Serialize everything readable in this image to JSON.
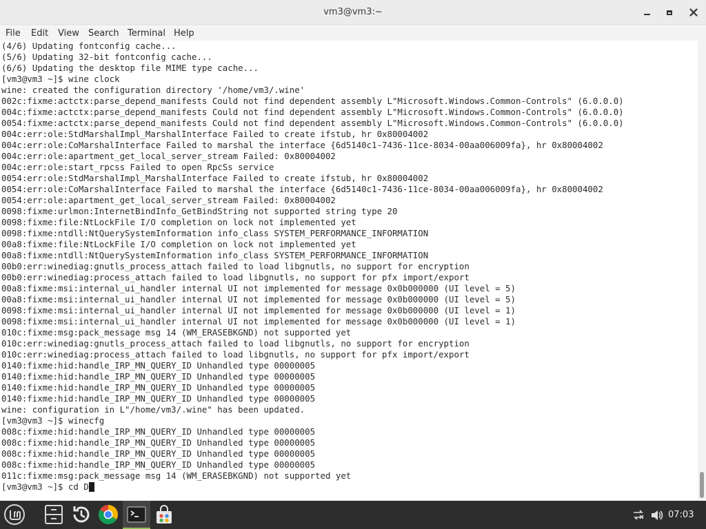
{
  "window": {
    "title": "vm3@vm3:~"
  },
  "menubar": {
    "items": [
      "File",
      "Edit",
      "View",
      "Search",
      "Terminal",
      "Help"
    ]
  },
  "terminal": {
    "lines": [
      "(4/6) Updating fontconfig cache...",
      "(5/6) Updating 32-bit fontconfig cache...",
      "(6/6) Updating the desktop file MIME type cache...",
      "[vm3@vm3 ~]$ wine clock",
      "wine: created the configuration directory '/home/vm3/.wine'",
      "002c:fixme:actctx:parse_depend_manifests Could not find dependent assembly L\"Microsoft.Windows.Common-Controls\" (6.0.0.0)",
      "004c:fixme:actctx:parse_depend_manifests Could not find dependent assembly L\"Microsoft.Windows.Common-Controls\" (6.0.0.0)",
      "0054:fixme:actctx:parse_depend_manifests Could not find dependent assembly L\"Microsoft.Windows.Common-Controls\" (6.0.0.0)",
      "004c:err:ole:StdMarshalImpl_MarshalInterface Failed to create ifstub, hr 0x80004002",
      "004c:err:ole:CoMarshalInterface Failed to marshal the interface {6d5140c1-7436-11ce-8034-00aa006009fa}, hr 0x80004002",
      "004c:err:ole:apartment_get_local_server_stream Failed: 0x80004002",
      "004c:err:ole:start_rpcss Failed to open RpcSs service",
      "0054:err:ole:StdMarshalImpl_MarshalInterface Failed to create ifstub, hr 0x80004002",
      "0054:err:ole:CoMarshalInterface Failed to marshal the interface {6d5140c1-7436-11ce-8034-00aa006009fa}, hr 0x80004002",
      "0054:err:ole:apartment_get_local_server_stream Failed: 0x80004002",
      "0098:fixme:urlmon:InternetBindInfo_GetBindString not supported string type 20",
      "0098:fixme:file:NtLockFile I/O completion on lock not implemented yet",
      "0098:fixme:ntdll:NtQuerySystemInformation info_class SYSTEM_PERFORMANCE_INFORMATION",
      "00a8:fixme:file:NtLockFile I/O completion on lock not implemented yet",
      "00a8:fixme:ntdll:NtQuerySystemInformation info_class SYSTEM_PERFORMANCE_INFORMATION",
      "00b0:err:winediag:gnutls_process_attach failed to load libgnutls, no support for encryption",
      "00b0:err:winediag:process_attach failed to load libgnutls, no support for pfx import/export",
      "00a8:fixme:msi:internal_ui_handler internal UI not implemented for message 0x0b000000 (UI level = 5)",
      "00a8:fixme:msi:internal_ui_handler internal UI not implemented for message 0x0b000000 (UI level = 5)",
      "0098:fixme:msi:internal_ui_handler internal UI not implemented for message 0x0b000000 (UI level = 1)",
      "0098:fixme:msi:internal_ui_handler internal UI not implemented for message 0x0b000000 (UI level = 1)",
      "010c:fixme:msg:pack_message msg 14 (WM_ERASEBKGND) not supported yet",
      "010c:err:winediag:gnutls_process_attach failed to load libgnutls, no support for encryption",
      "010c:err:winediag:process_attach failed to load libgnutls, no support for pfx import/export",
      "0140:fixme:hid:handle_IRP_MN_QUERY_ID Unhandled type 00000005",
      "0140:fixme:hid:handle_IRP_MN_QUERY_ID Unhandled type 00000005",
      "0140:fixme:hid:handle_IRP_MN_QUERY_ID Unhandled type 00000005",
      "0140:fixme:hid:handle_IRP_MN_QUERY_ID Unhandled type 00000005",
      "wine: configuration in L\"/home/vm3/.wine\" has been updated.",
      "[vm3@vm3 ~]$ winecfg",
      "008c:fixme:hid:handle_IRP_MN_QUERY_ID Unhandled type 00000005",
      "008c:fixme:hid:handle_IRP_MN_QUERY_ID Unhandled type 00000005",
      "008c:fixme:hid:handle_IRP_MN_QUERY_ID Unhandled type 00000005",
      "008c:fixme:hid:handle_IRP_MN_QUERY_ID Unhandled type 00000005",
      "011c:fixme:msg:pack_message msg 14 (WM_ERASEBKGND) not supported yet"
    ],
    "prompt": "[vm3@vm3 ~]$ cd D"
  },
  "taskbar": {
    "apps": [
      "menu-icon",
      "files-icon",
      "timeshift-icon",
      "chrome-icon",
      "terminal-icon",
      "software-manager-icon"
    ],
    "clock": "07:03"
  },
  "colors": {
    "taskbar_bg": "#2d2d2d",
    "terminal_bg": "#ffffff",
    "terminal_fg": "#2b2b2b",
    "accent": "#8fbc5a"
  }
}
